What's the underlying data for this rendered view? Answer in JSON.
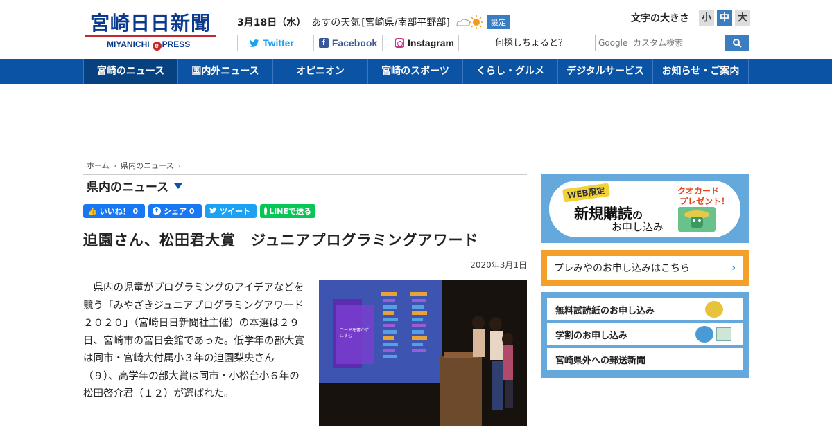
{
  "header": {
    "logo_jp": "宮崎日日新聞",
    "logo_en_left": "MIYANICHI",
    "logo_en_mark": "e",
    "logo_en_right": "PRESS",
    "weather": {
      "date": "3月18日（水）",
      "label": "あすの天気",
      "region": "[宮崎県/南部平野部]",
      "setting_label": "設定"
    },
    "font_size": {
      "label": "文字の大きさ",
      "options": [
        "小",
        "中",
        "大"
      ],
      "selected": "中"
    },
    "sns": {
      "twitter": "Twitter",
      "facebook": "Facebook",
      "instagram": "Instagram"
    },
    "whatsup": "何探しちょると？",
    "search": {
      "placeholder": "Google  カスタム検索"
    }
  },
  "nav": {
    "items": [
      "宮崎のニュース",
      "国内外ニュース",
      "オピニオン",
      "宮崎のスポーツ",
      "くらし・グルメ",
      "デジタルサービス",
      "お知らせ・ご案内"
    ]
  },
  "breadcrumb": [
    "ホーム",
    "県内のニュース"
  ],
  "section": {
    "title": "県内のニュース"
  },
  "share": {
    "like": "いいね！ 0",
    "share": "シェア 0",
    "tweet": "ツイート",
    "line": "LINEで送る"
  },
  "article": {
    "headline": "迫園さん、松田君大賞　ジュニアプログラミングアワード",
    "date": "2020年3月1日",
    "body": "　県内の児童がプログラミングのアイデアなどを競う「みやざきジュニアプログラミングアワード２０２０」（宮崎日日新聞社主催）の本選は２９日、宮崎市の宮日会館であった。低学年の部大賞は同市・宮崎大付属小３年の迫園梨央さん（９）、高学年の部大賞は同市・小松台小６年の松田啓介君（１２）が選ばれた。",
    "photo_screen_text": "コードを書かずにすむ"
  },
  "sidebar": {
    "ad_web": {
      "tag": "WEB限定",
      "main": "新規購読",
      "main_small": "の",
      "sub": "お申し込み",
      "promo_line1": "クオカード",
      "promo_line2": "プレゼント！"
    },
    "premium": "プレみやのお申し込みはこちら",
    "subscriptions": [
      "無料試読紙のお申し込み",
      "学割のお申し込み",
      "宮崎県外への郵送新聞"
    ]
  },
  "colors": {
    "nav_bg": "#0b53a4",
    "accent": "#3b7dc1",
    "logo_red": "#c3282e",
    "premium_orange": "#f4a028",
    "sidebar_blue": "#64a8dc"
  }
}
